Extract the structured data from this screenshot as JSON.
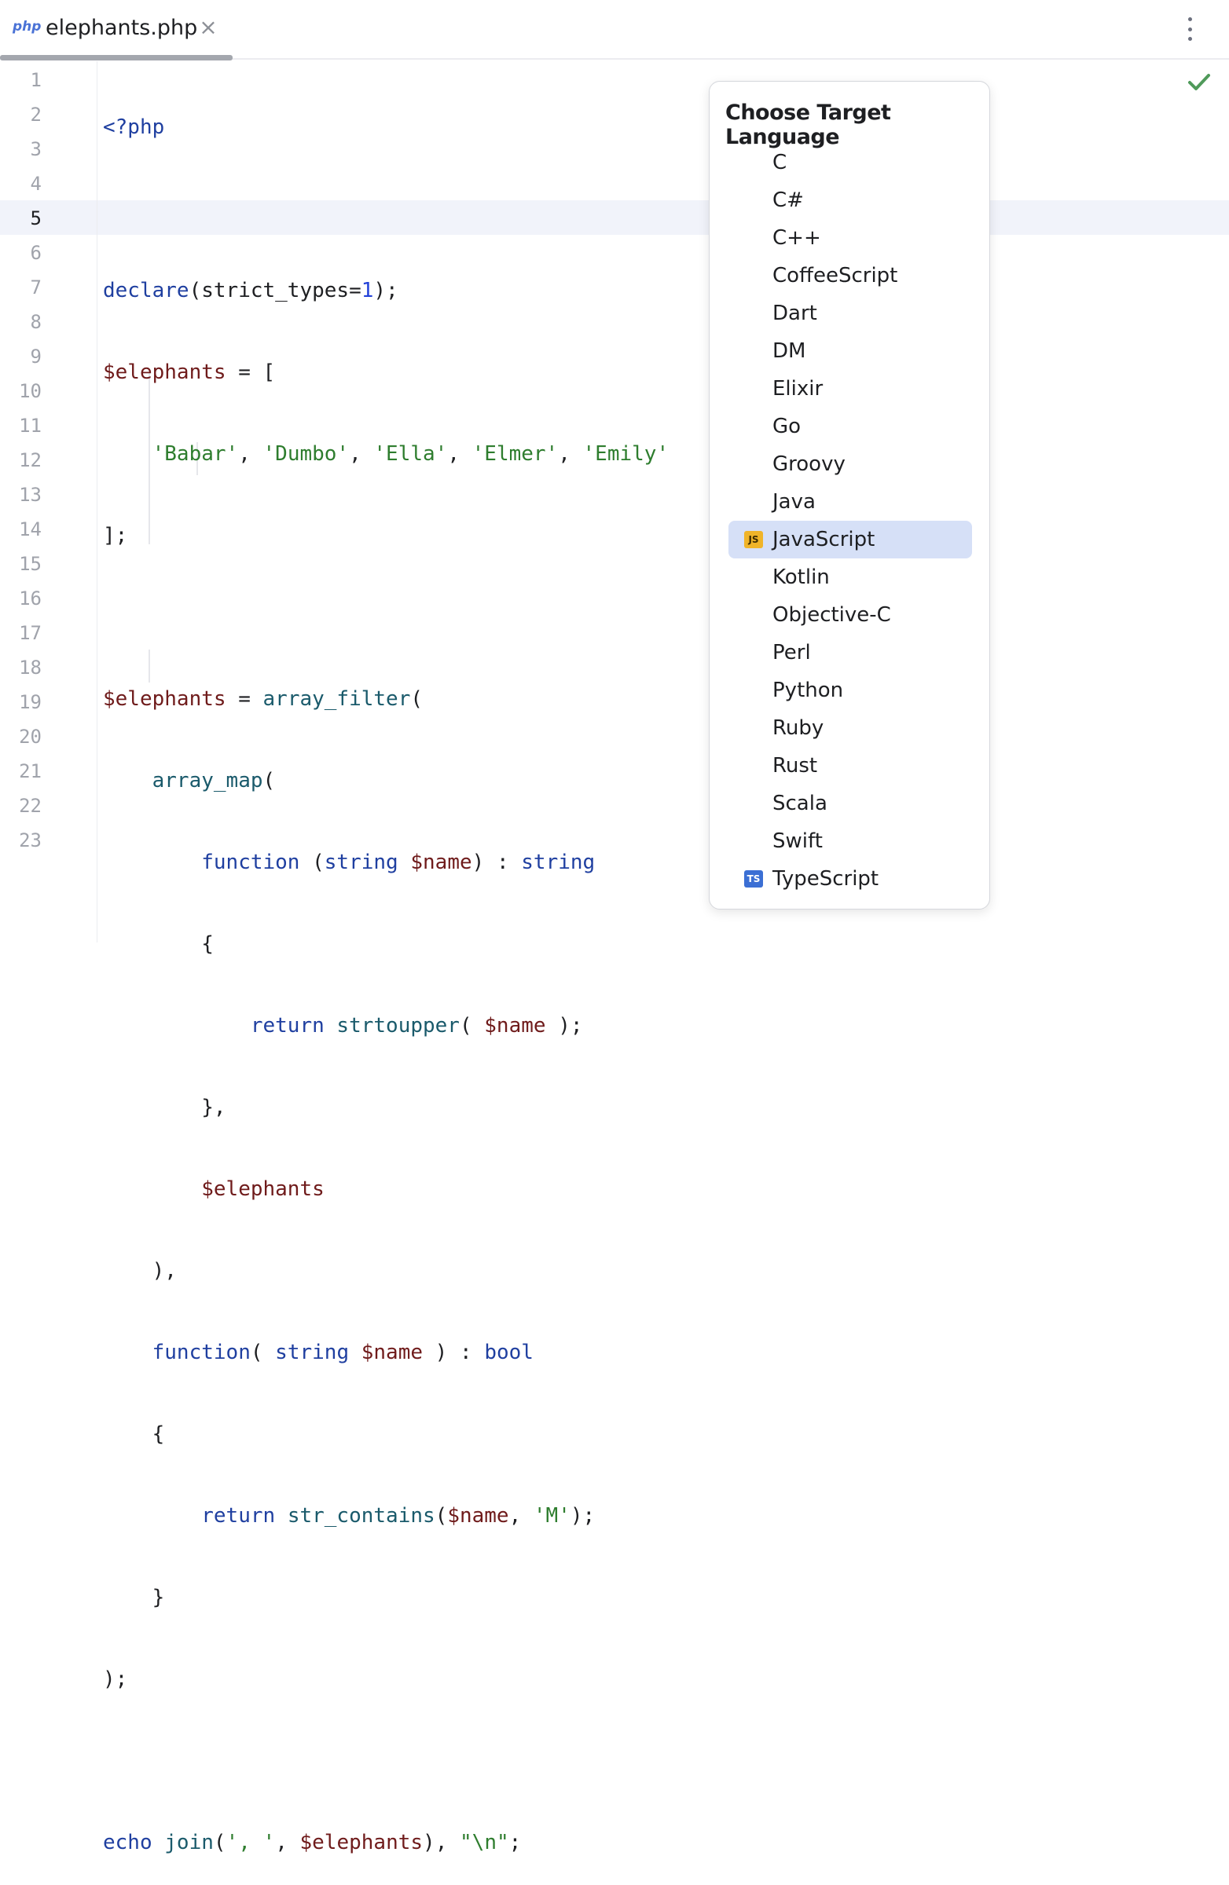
{
  "tab": {
    "icon": "php",
    "title": "elephants.php",
    "close_glyph": "×"
  },
  "editor": {
    "line_numbers": [
      "1",
      "2",
      "3",
      "4",
      "5",
      "6",
      "7",
      "8",
      "9",
      "10",
      "11",
      "12",
      "13",
      "14",
      "15",
      "16",
      "17",
      "18",
      "19",
      "20",
      "21",
      "22",
      "23"
    ],
    "current_line": "5",
    "status": "no-problems-check-icon"
  },
  "popup": {
    "title": "Choose Target Language",
    "languages": [
      {
        "label": "C"
      },
      {
        "label": "C#"
      },
      {
        "label": "C++"
      },
      {
        "label": "CoffeeScript"
      },
      {
        "label": "Dart"
      },
      {
        "label": "DM"
      },
      {
        "label": "Elixir"
      },
      {
        "label": "Go"
      },
      {
        "label": "Groovy"
      },
      {
        "label": "Java"
      },
      {
        "label": "JavaScript",
        "icon": "JS",
        "icon_bg": "#f0b429",
        "icon_fg": "#3b2a00",
        "selected": true
      },
      {
        "label": "Kotlin"
      },
      {
        "label": "Objective-C"
      },
      {
        "label": "Perl"
      },
      {
        "label": "Python"
      },
      {
        "label": "Ruby"
      },
      {
        "label": "Rust"
      },
      {
        "label": "Scala"
      },
      {
        "label": "Swift"
      },
      {
        "label": "TypeScript",
        "icon": "TS",
        "icon_bg": "#3b6fd4",
        "icon_fg": "#ffffff"
      }
    ]
  },
  "code_tokens": {
    "l1": [
      "<?php"
    ],
    "l3": [
      "declare",
      "(strict_types=",
      "1",
      ");"
    ],
    "l4": [
      "$elephants",
      " = ["
    ],
    "l5": [
      "    ",
      "'Babar'",
      ", ",
      "'Dumbo'",
      ", ",
      "'Ella'",
      ", ",
      "'Elmer'",
      ", ",
      "'Emily'"
    ],
    "l6": [
      "];"
    ],
    "l8": [
      "$elephants",
      " = ",
      "array_filter",
      "("
    ],
    "l9": [
      "    ",
      "array_map",
      "("
    ],
    "l10": [
      "        ",
      "function",
      " (",
      "string",
      " ",
      "$name",
      ") : ",
      "string"
    ],
    "l11": [
      "        {"
    ],
    "l12": [
      "            ",
      "return",
      " ",
      "strtoupper",
      "( ",
      "$name",
      " );"
    ],
    "l13": [
      "        },"
    ],
    "l14": [
      "        ",
      "$elephants"
    ],
    "l15": [
      "    ),"
    ],
    "l16": [
      "    ",
      "function",
      "( ",
      "string",
      " ",
      "$name",
      " ) : ",
      "bool"
    ],
    "l17": [
      "    {"
    ],
    "l18": [
      "        ",
      "return",
      " ",
      "str_contains",
      "(",
      "$name",
      ", ",
      "'M'",
      ");"
    ],
    "l19": [
      "    }"
    ],
    "l20": [
      ");"
    ],
    "l22": [
      "echo",
      " ",
      "join",
      "(",
      "', '",
      ", ",
      "$elephants",
      "), ",
      "\"\\n\"",
      ";"
    ]
  }
}
